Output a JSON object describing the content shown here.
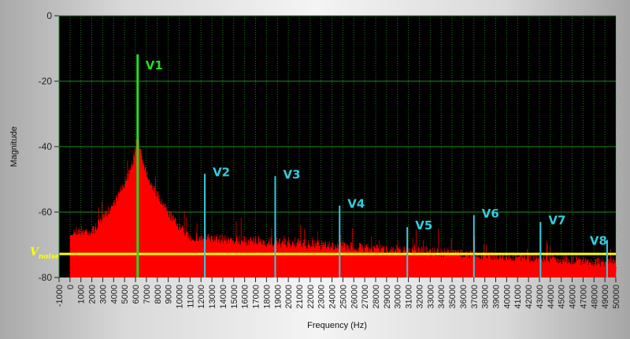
{
  "chart_data": {
    "type": "bar",
    "xlabel": "Frequency (Hz)",
    "ylabel": "Magnitude",
    "xlim": [
      -1000,
      50000
    ],
    "ylim": [
      -80,
      0
    ],
    "xticks": [
      -1000,
      0,
      1000,
      2000,
      3000,
      4000,
      5000,
      6000,
      7000,
      8000,
      9000,
      10000,
      11000,
      12000,
      13000,
      14000,
      15000,
      16000,
      17000,
      18000,
      19000,
      20000,
      21000,
      22000,
      23000,
      24000,
      25000,
      26000,
      27000,
      28000,
      29000,
      30000,
      31000,
      32000,
      33000,
      34000,
      35000,
      36000,
      37000,
      38000,
      39000,
      40000,
      41000,
      42000,
      43000,
      44000,
      45000,
      46000,
      47000,
      48000,
      49000,
      50000
    ],
    "yticks": [
      0,
      -20,
      -40,
      -60,
      -80
    ],
    "grid": true,
    "background": "#000000",
    "spectrum_color": "#ff0000",
    "fundamental": {
      "label": "V1",
      "freq": 6200,
      "magnitude": -11.8,
      "color": "#22dd22"
    },
    "harmonics": [
      {
        "label": "V2",
        "freq": 12350,
        "magnitude": -48.3
      },
      {
        "label": "V3",
        "freq": 18800,
        "magnitude": -49
      },
      {
        "label": "V4",
        "freq": 24700,
        "magnitude": -58
      },
      {
        "label": "V5",
        "freq": 30900,
        "magnitude": -64.6
      },
      {
        "label": "V6",
        "freq": 37000,
        "magnitude": -61
      },
      {
        "label": "V7",
        "freq": 43100,
        "magnitude": -63
      },
      {
        "label": "V8",
        "freq": 49200,
        "magnitude": -68.5
      }
    ],
    "harmonic_color": "#33ccdd",
    "noise": {
      "label": "V",
      "subscript": "noise",
      "magnitude": -72.8,
      "color": "#ffff00"
    }
  }
}
